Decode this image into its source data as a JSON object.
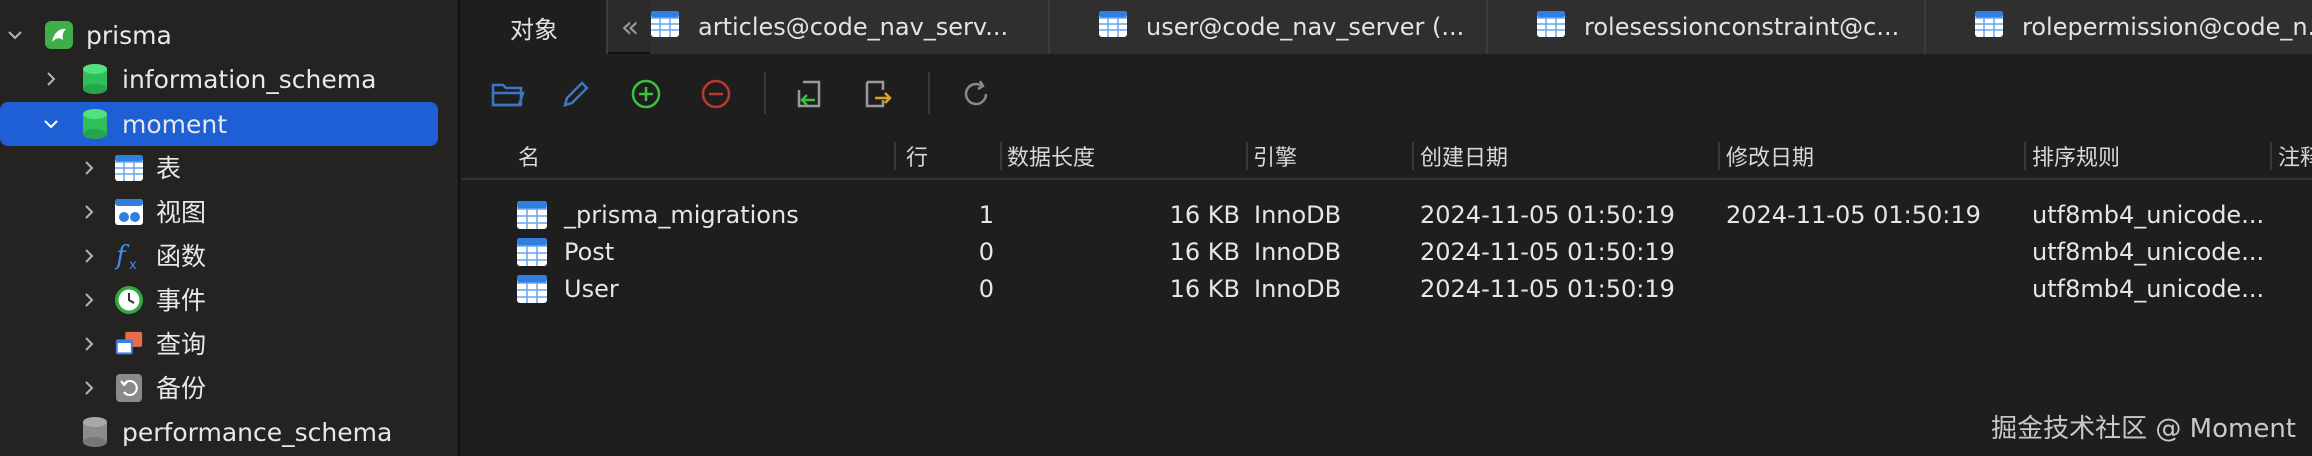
{
  "sidebar": {
    "items": [
      {
        "label": "prisma",
        "expanded": true
      },
      {
        "label": "information_schema"
      },
      {
        "label": "moment",
        "selected": true,
        "expanded": true
      },
      {
        "label": "表"
      },
      {
        "label": "视图"
      },
      {
        "label": "函数"
      },
      {
        "label": "事件"
      },
      {
        "label": "查询"
      },
      {
        "label": "备份"
      },
      {
        "label": "performance_schema"
      }
    ]
  },
  "tabs": [
    {
      "label": "对象",
      "active": true
    },
    {
      "label": "articles@code_nav_serv..."
    },
    {
      "label": "user@code_nav_server (..."
    },
    {
      "label": "rolesessionconstraint@c..."
    },
    {
      "label": "rolepermission@code_n..."
    }
  ],
  "table": {
    "columns": [
      "名",
      "行",
      "数据长度",
      "引擎",
      "创建日期",
      "修改日期",
      "排序规则",
      "注释"
    ],
    "rows": [
      {
        "name": "_prisma_migrations",
        "rows": "1",
        "data_length": "16 KB",
        "engine": "InnoDB",
        "created": "2024-11-05 01:50:19",
        "modified": "2024-11-05 01:50:19",
        "collation": "utf8mb4_unicode..."
      },
      {
        "name": "Post",
        "rows": "0",
        "data_length": "16 KB",
        "engine": "InnoDB",
        "created": "2024-11-05 01:50:19",
        "modified": "",
        "collation": "utf8mb4_unicode..."
      },
      {
        "name": "User",
        "rows": "0",
        "data_length": "16 KB",
        "engine": "InnoDB",
        "created": "2024-11-05 01:50:19",
        "modified": "",
        "collation": "utf8mb4_unicode..."
      }
    ]
  },
  "watermark": "掘金技术社区 @ Moment",
  "colors": {
    "selection": "#1f5fd6",
    "db_green": "#2fbf5a",
    "add_green": "#3cc13c",
    "remove_red": "#c0392b"
  }
}
